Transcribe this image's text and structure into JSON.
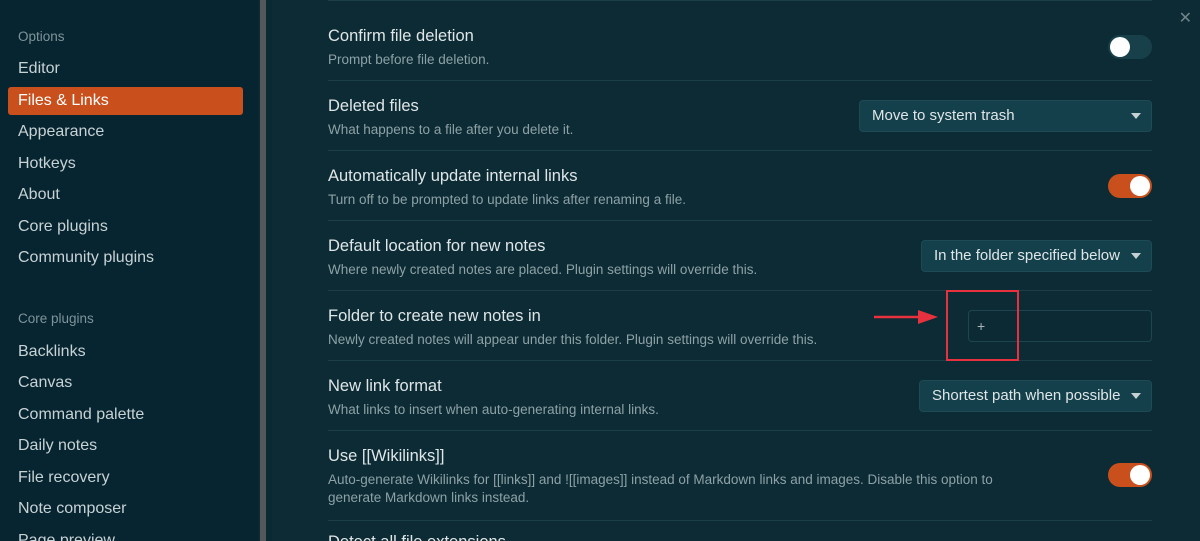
{
  "sidebar": {
    "options_heading": "Options",
    "options": [
      {
        "label": "Editor",
        "active": false
      },
      {
        "label": "Files & Links",
        "active": true
      },
      {
        "label": "Appearance",
        "active": false
      },
      {
        "label": "Hotkeys",
        "active": false
      },
      {
        "label": "About",
        "active": false
      },
      {
        "label": "Core plugins",
        "active": false
      },
      {
        "label": "Community plugins",
        "active": false
      }
    ],
    "core_heading": "Core plugins",
    "core": [
      {
        "label": "Backlinks"
      },
      {
        "label": "Canvas"
      },
      {
        "label": "Command palette"
      },
      {
        "label": "Daily notes"
      },
      {
        "label": "File recovery"
      },
      {
        "label": "Note composer"
      },
      {
        "label": "Page preview"
      }
    ]
  },
  "settings": {
    "confirm_deletion": {
      "name": "Confirm file deletion",
      "desc": "Prompt before file deletion.",
      "toggle": "off"
    },
    "deleted_files": {
      "name": "Deleted files",
      "desc": "What happens to a file after you delete it.",
      "value": "Move to system trash"
    },
    "auto_update_links": {
      "name": "Automatically update internal links",
      "desc": "Turn off to be prompted to update links after renaming a file.",
      "toggle": "on"
    },
    "default_location": {
      "name": "Default location for new notes",
      "desc": "Where newly created notes are placed. Plugin settings will override this.",
      "value": "In the folder specified below"
    },
    "new_notes_folder": {
      "name": "Folder to create new notes in",
      "desc": "Newly created notes will appear under this folder. Plugin settings will override this.",
      "placeholder": "+"
    },
    "link_format": {
      "name": "New link format",
      "desc": "What links to insert when auto-generating internal links.",
      "value": "Shortest path when possible"
    },
    "wikilinks": {
      "name": "Use [[Wikilinks]]",
      "desc": "Auto-generate Wikilinks for [[links]] and ![[images]] instead of Markdown links and images. Disable this option to generate Markdown links instead.",
      "toggle": "on"
    },
    "detect_extensions": {
      "name": "Detect all file extensions"
    }
  },
  "colors": {
    "accent": "#c9501c",
    "annotation": "#e8313f",
    "background": "#0b2a33"
  },
  "icons": {
    "close": "close-icon",
    "dropdown": "chevron-down-icon",
    "annotation": "arrow-right-icon"
  }
}
